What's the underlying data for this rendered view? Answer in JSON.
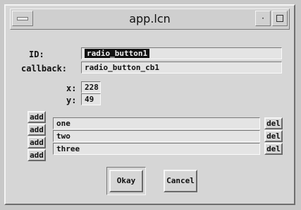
{
  "window": {
    "title": "app.lcn"
  },
  "form": {
    "id_label": "ID:",
    "id_value": "radio_button1",
    "callback_label": "callback:",
    "callback_value": "radio_button_cb1",
    "x_label": "x:",
    "x_value": "228",
    "y_label": "y:",
    "y_value": "49"
  },
  "list": {
    "add_label": "add",
    "del_label": "del",
    "items": [
      "one",
      "two",
      "three"
    ]
  },
  "buttons": {
    "okay": "Okay",
    "cancel": "Cancel"
  }
}
